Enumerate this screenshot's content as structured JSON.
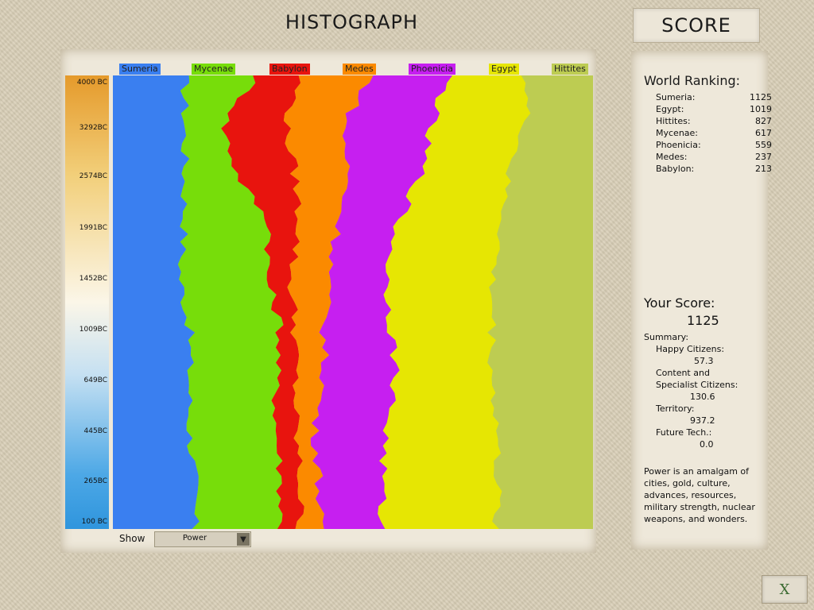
{
  "header": {
    "title": "HISTOGRAPH",
    "score_tab": "SCORE"
  },
  "axis": {
    "years": [
      {
        "label": "4000 BC",
        "pos": 0.016
      },
      {
        "label": "3292BC",
        "pos": 0.115
      },
      {
        "label": "2574BC",
        "pos": 0.223
      },
      {
        "label": "1991BC",
        "pos": 0.336
      },
      {
        "label": "1452BC",
        "pos": 0.448
      },
      {
        "label": "1009BC",
        "pos": 0.56
      },
      {
        "label": "649BC",
        "pos": 0.672
      },
      {
        "label": "445BC",
        "pos": 0.784
      },
      {
        "label": "265BC",
        "pos": 0.895
      },
      {
        "label": "100 BC",
        "pos": 0.984
      }
    ]
  },
  "chart_data": {
    "type": "area",
    "stacked": "normalized",
    "orientation": "horizontal",
    "y_axis": [
      "4000 BC",
      "3292BC",
      "2574BC",
      "1991BC",
      "1452BC",
      "1009BC",
      "649BC",
      "445BC",
      "265BC",
      "100 BC"
    ],
    "series": [
      {
        "name": "Sumeria",
        "color": "#3a7ff0",
        "boundaries": [
          0.15,
          0.15,
          0.15,
          0.15,
          0.14,
          0.16,
          0.16,
          0.16,
          0.17,
          0.17
        ]
      },
      {
        "name": "Mycenae",
        "color": "#77dd0a",
        "boundaries": [
          0.3,
          0.23,
          0.26,
          0.33,
          0.32,
          0.35,
          0.34,
          0.34,
          0.35,
          0.35
        ]
      },
      {
        "name": "Babylon",
        "color": "#e8140e",
        "boundaries": [
          0.39,
          0.36,
          0.38,
          0.39,
          0.37,
          0.38,
          0.38,
          0.38,
          0.39,
          0.39
        ]
      },
      {
        "name": "Medes",
        "color": "#fb8a00",
        "boundaries": [
          0.54,
          0.48,
          0.49,
          0.47,
          0.45,
          0.44,
          0.44,
          0.42,
          0.43,
          0.43
        ]
      },
      {
        "name": "Phoenicia",
        "color": "#c61ff0",
        "boundaries": [
          0.7,
          0.66,
          0.64,
          0.59,
          0.57,
          0.58,
          0.59,
          0.57,
          0.56,
          0.56
        ]
      },
      {
        "name": "Egypt",
        "color": "#e6e603",
        "boundaries": [
          0.86,
          0.86,
          0.82,
          0.81,
          0.79,
          0.79,
          0.79,
          0.8,
          0.8,
          0.8
        ]
      },
      {
        "name": "Hittites",
        "color": "#bdcc52",
        "boundaries": [
          1,
          1,
          1,
          1,
          1,
          1,
          1,
          1,
          1,
          1
        ]
      }
    ]
  },
  "show": {
    "label": "Show",
    "selected": "Power"
  },
  "ranking": {
    "title": "World Ranking:",
    "rows": [
      {
        "name": "Sumeria:",
        "value": "1125"
      },
      {
        "name": "Egypt:",
        "value": "1019"
      },
      {
        "name": "Hittites:",
        "value": "827"
      },
      {
        "name": "Mycenae:",
        "value": "617"
      },
      {
        "name": "Phoenicia:",
        "value": "559"
      },
      {
        "name": "Medes:",
        "value": "237"
      },
      {
        "name": "Babylon:",
        "value": "213"
      }
    ]
  },
  "your_score": {
    "title": "Your Score:",
    "value": "1125",
    "summary_label": "Summary:",
    "happy_label": "Happy Citizens:",
    "happy_value": "57.3",
    "content_label_1": "Content and",
    "content_label_2": "Specialist Citizens:",
    "content_value": "130.6",
    "territory_label": "Territory:",
    "territory_value": "937.2",
    "future_label": "Future Tech.:",
    "future_value": "0.0",
    "note_1": "Power is an amalgam of",
    "note_2": "cities, gold, culture,",
    "note_3": "advances, resources,",
    "note_4": "military strength, nuclear",
    "note_5": "weapons, and wonders."
  },
  "close": {
    "label": "X"
  }
}
